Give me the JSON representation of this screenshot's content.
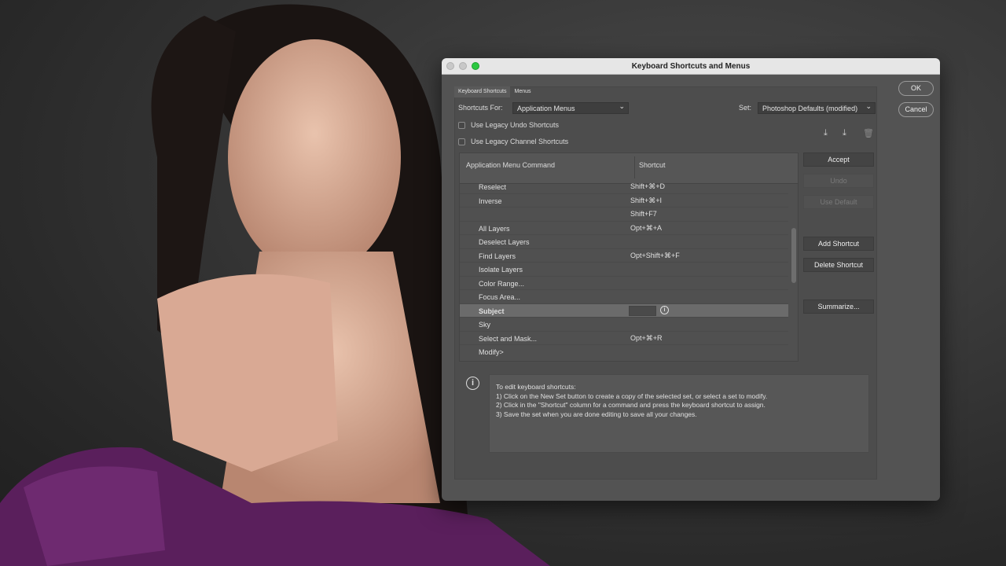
{
  "window": {
    "title": "Keyboard Shortcuts and Menus"
  },
  "tabs": [
    "Keyboard Shortcuts",
    "Menus"
  ],
  "shortcuts_for": {
    "label": "Shortcuts For:",
    "value": "Application Menus"
  },
  "set": {
    "label": "Set:",
    "value": "Photoshop Defaults (modified)"
  },
  "checkboxes": [
    "Use Legacy Undo Shortcuts",
    "Use Legacy Channel Shortcuts"
  ],
  "table": {
    "headers": [
      "Application Menu Command",
      "Shortcut"
    ],
    "rows": [
      {
        "command": "Reselect",
        "shortcut": "Shift+⌘+D"
      },
      {
        "command": "Inverse",
        "shortcut": "Shift+⌘+I"
      },
      {
        "command": "",
        "shortcut": "Shift+F7"
      },
      {
        "command": "All Layers",
        "shortcut": "Opt+⌘+A"
      },
      {
        "command": "Deselect Layers",
        "shortcut": ""
      },
      {
        "command": "Find Layers",
        "shortcut": "Opt+Shift+⌘+F"
      },
      {
        "command": "Isolate Layers",
        "shortcut": ""
      },
      {
        "command": "Color Range...",
        "shortcut": ""
      },
      {
        "command": "Focus Area...",
        "shortcut": ""
      },
      {
        "command": "Subject",
        "shortcut": ""
      },
      {
        "command": "Sky",
        "shortcut": ""
      },
      {
        "command": "Select and Mask...",
        "shortcut": "Opt+⌘+R"
      },
      {
        "command": "Modify>",
        "shortcut": ""
      }
    ]
  },
  "buttons": {
    "ok": "OK",
    "cancel": "Cancel",
    "accept": "Accept",
    "undo": "Undo",
    "use_default": "Use Default",
    "add_shortcut": "Add Shortcut",
    "delete_shortcut": "Delete Shortcut",
    "summarize": "Summarize..."
  },
  "info": {
    "lines": [
      "To edit keyboard shortcuts:",
      "1) Click on the New Set button to create a copy of the selected set, or select a set to modify.",
      "2) Click in the \"Shortcut\" column for a command and press the keyboard shortcut to assign.",
      "3) Save the set when you are done editing to save all your changes."
    ]
  }
}
